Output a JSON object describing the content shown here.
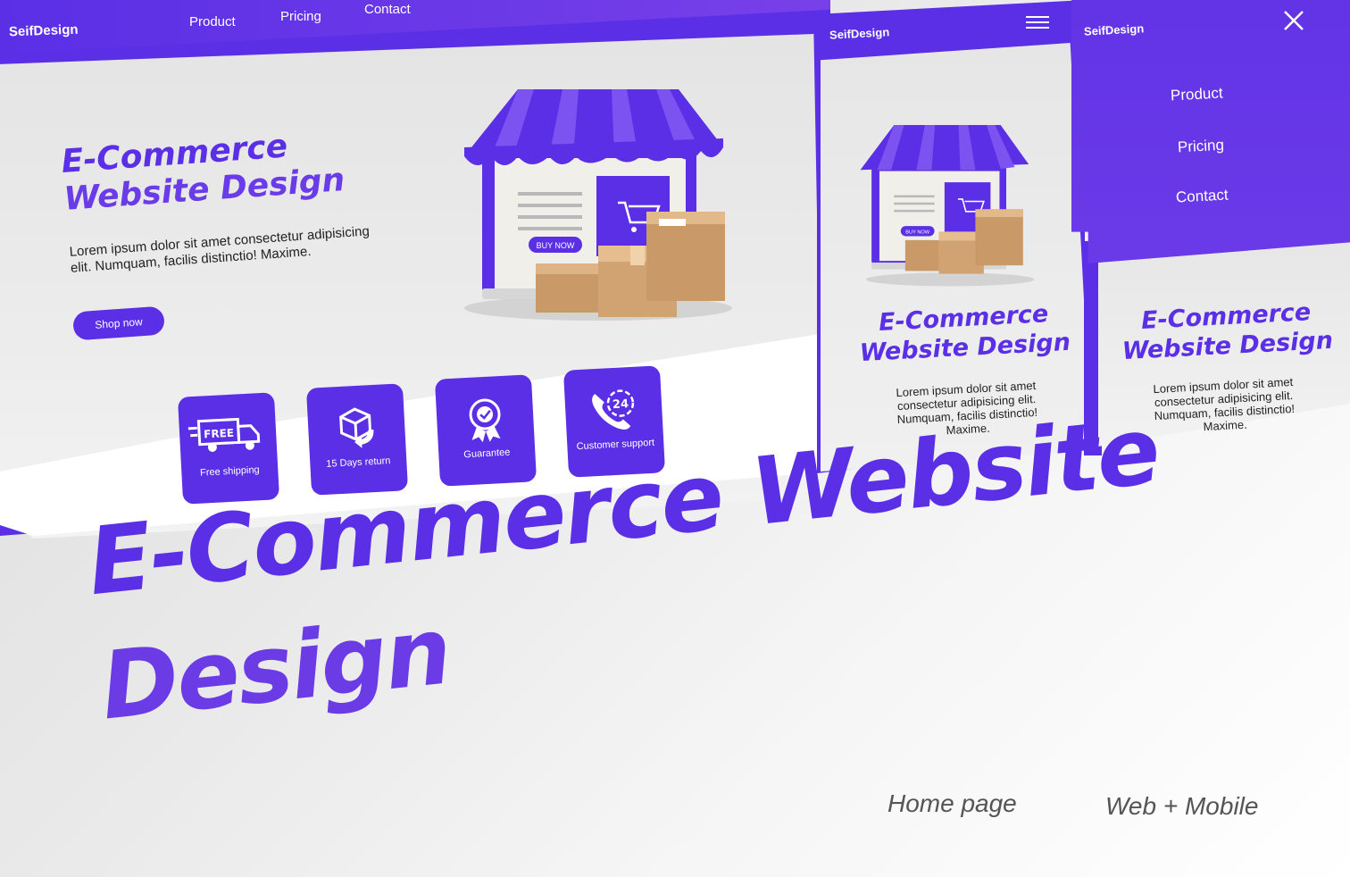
{
  "brand": {
    "logo": "SeifDesign",
    "primary_color": "#5a2fe6",
    "accent_color": "#7840e8"
  },
  "desktop": {
    "nav": {
      "product": "Product",
      "pricing": "Pricing",
      "contact": "Contact"
    },
    "hero": {
      "title_line1": "E-Commerce",
      "title_line2": "Website Design",
      "body": "Lorem ipsum dolor sit amet consectetur adipisicing elit. Numquam, facilis distinctio! Maxime.",
      "cta": "Shop now"
    },
    "illustration": {
      "buy_now": "BUY NOW",
      "badge": "FREE"
    },
    "features": [
      {
        "label": "Free shipping",
        "icon": "truck-icon"
      },
      {
        "label": "15 Days return",
        "icon": "box-return-icon"
      },
      {
        "label": "Guarantee",
        "icon": "badge-check-icon"
      },
      {
        "label": "Customer support",
        "icon": "phone-24-icon"
      }
    ]
  },
  "mobile_home": {
    "hero": {
      "title_line1": "E-Commerce",
      "title_line2": "Website Design",
      "body": "Lorem ipsum dolor sit amet consectetur adipisicing elit. Numquam, facilis distinctio! Maxime."
    },
    "illustration": {
      "buy_now": "BUY NOW"
    }
  },
  "mobile_menu": {
    "items": [
      "Product",
      "Pricing",
      "Contact"
    ],
    "hero": {
      "title_line1": "E-Commerce",
      "title_line2": "Website Design",
      "body": "Lorem ipsum dolor sit amet consectetur adipisicing elit. Numquam, facilis distinctio! Maxime."
    }
  },
  "headline": {
    "line1": "E-Commerce Website",
    "line2": "Design"
  },
  "captions": {
    "left": "Home page",
    "right": "Web + Mobile"
  }
}
